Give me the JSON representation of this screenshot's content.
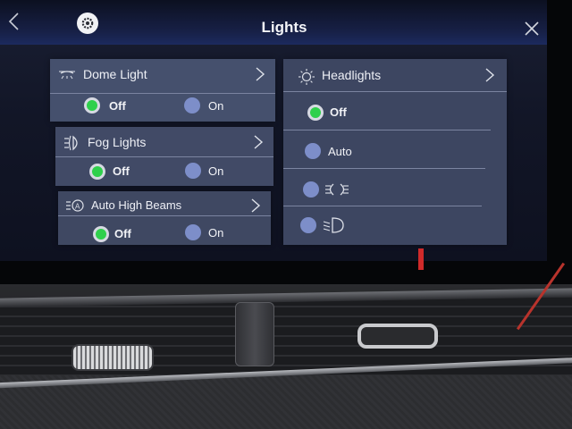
{
  "header": {
    "title": "Lights"
  },
  "dome_light": {
    "label": "Dome Light",
    "icon": "dome-light-icon",
    "options": [
      {
        "label": "Off",
        "selected": true
      },
      {
        "label": "On",
        "selected": false
      }
    ]
  },
  "fog_lights": {
    "label": "Fog Lights",
    "icon": "fog-light-icon",
    "options": [
      {
        "label": "Off",
        "selected": true
      },
      {
        "label": "On",
        "selected": false
      }
    ]
  },
  "auto_high_beams": {
    "label": "Auto High Beams",
    "icon": "auto-high-beam-icon",
    "options": [
      {
        "label": "Off",
        "selected": true
      },
      {
        "label": "On",
        "selected": false
      }
    ]
  },
  "headlights": {
    "label": "Headlights",
    "icon": "headlight-sun-icon",
    "options": [
      {
        "label": "Off",
        "selected": true
      },
      {
        "label": "Auto",
        "selected": false
      },
      {
        "label": "",
        "icon": "parking-lights-icon",
        "selected": false
      },
      {
        "label": "",
        "icon": "low-beam-icon",
        "selected": false
      }
    ]
  },
  "colors": {
    "selected": "#2ccd4a",
    "unselected": "#7d8ec9",
    "panel": "#414a66",
    "text": "#f2f3f7"
  }
}
